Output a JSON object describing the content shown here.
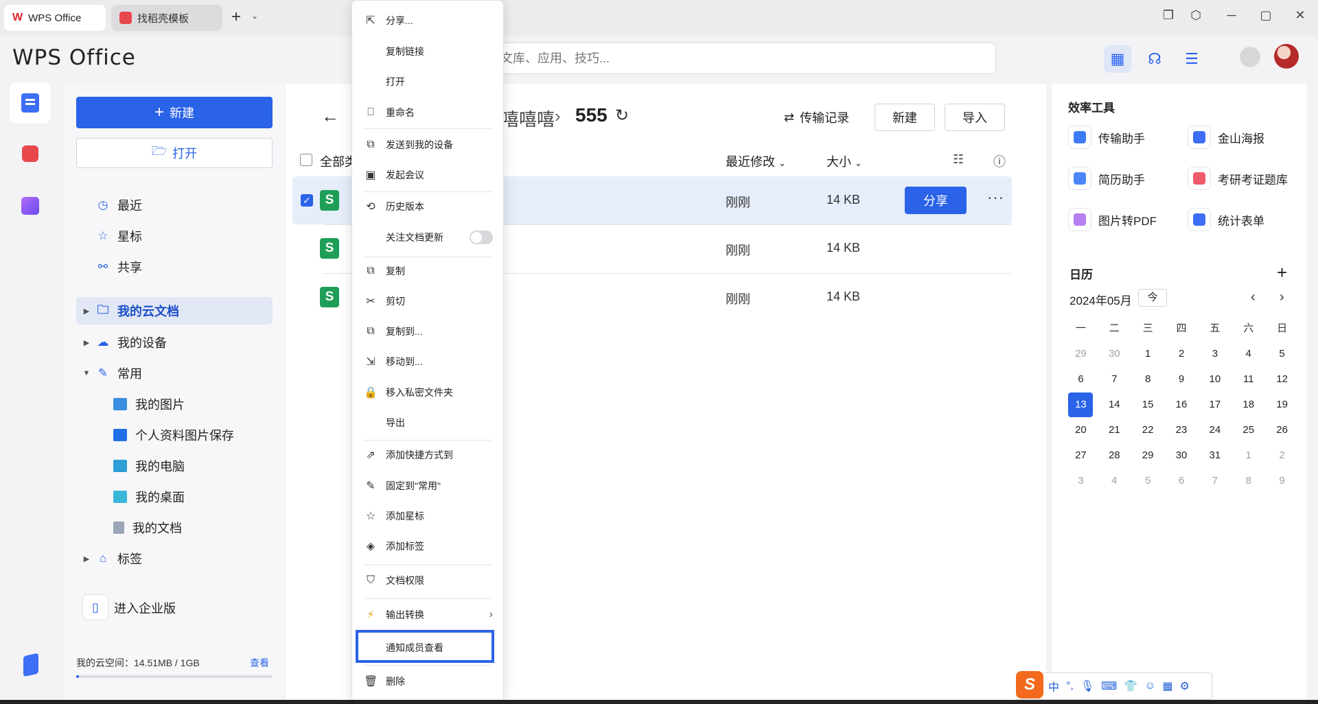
{
  "tabs": [
    {
      "label": "WPS Office"
    },
    {
      "label": "找稻壳模板"
    }
  ],
  "brand": "WPS Office",
  "search": {
    "placeholder": "文库、应用、技巧..."
  },
  "left": {
    "new_label": "新建",
    "open_label": "打开",
    "nav": [
      {
        "label": "最近"
      },
      {
        "label": "星标"
      },
      {
        "label": "共享"
      },
      {
        "label": "我的云文档"
      },
      {
        "label": "我的设备"
      },
      {
        "label": "常用"
      },
      {
        "label": "我的图片"
      },
      {
        "label": "个人资料图片保存"
      },
      {
        "label": "我的电脑"
      },
      {
        "label": "我的桌面"
      },
      {
        "label": "我的文档"
      },
      {
        "label": "标签"
      }
    ],
    "enterprise_label": "进入企业版",
    "quota_label": "我的云空间：14.51MB / 1GB",
    "quota_link": "查看",
    "quota_fraction": 0.014
  },
  "main": {
    "breadcrumb_prev": "嘻嘻嘻",
    "breadcrumb_current": "555",
    "transfer_label": "传输记录",
    "new_label": "新建",
    "import_label": "导入",
    "select_all_label": "全部类",
    "col_modified": "最近修改",
    "col_size": "大小",
    "rows": [
      {
        "icon": "S",
        "time": "刚刚",
        "size": "14 KB",
        "share": "分享"
      },
      {
        "icon": "S",
        "time": "刚刚",
        "size": "14 KB"
      },
      {
        "icon": "S",
        "time": "刚刚",
        "size": "14 KB"
      }
    ]
  },
  "right": {
    "tools_title": "效率工具",
    "tools": [
      {
        "label": "传输助手",
        "color": "#3d7bf5"
      },
      {
        "label": "金山海报",
        "color": "#3d6ef5"
      },
      {
        "label": "简历助手",
        "color": "#4a86f7"
      },
      {
        "label": "考研考证题库",
        "color": "#ef5b6a"
      },
      {
        "label": "图片转PDF",
        "color": "#b77ef0"
      },
      {
        "label": "统计表单",
        "color": "#3d6ef5"
      }
    ],
    "calendar_title": "日历",
    "month": "2024年05月",
    "today_btn": "今",
    "weekdays": [
      "一",
      "二",
      "三",
      "四",
      "五",
      "六",
      "日"
    ],
    "weeks": [
      [
        "29",
        "30",
        "1",
        "2",
        "3",
        "4",
        "5"
      ],
      [
        "6",
        "7",
        "8",
        "9",
        "10",
        "11",
        "12"
      ],
      [
        "13",
        "14",
        "15",
        "16",
        "17",
        "18",
        "19"
      ],
      [
        "20",
        "21",
        "22",
        "23",
        "24",
        "25",
        "26"
      ],
      [
        "27",
        "28",
        "29",
        "30",
        "31",
        "1",
        "2"
      ],
      [
        "3",
        "4",
        "5",
        "6",
        "7",
        "8",
        "9"
      ]
    ],
    "today": "13"
  },
  "menu": [
    {
      "label": "分享..."
    },
    {
      "label": "复制链接"
    },
    {
      "label": "打开"
    },
    {
      "label": "重命名"
    },
    {
      "label": "发送到我的设备"
    },
    {
      "label": "发起会议"
    },
    {
      "label": "历史版本"
    },
    {
      "label": "关注文档更新"
    },
    {
      "label": "复制"
    },
    {
      "label": "剪切"
    },
    {
      "label": "复制到..."
    },
    {
      "label": "移动到..."
    },
    {
      "label": "移入私密文件夹"
    },
    {
      "label": "导出"
    },
    {
      "label": "添加快捷方式到"
    },
    {
      "label": "固定到\"常用\""
    },
    {
      "label": "添加星标"
    },
    {
      "label": "添加标签"
    },
    {
      "label": "文档权限"
    },
    {
      "label": "输出转换"
    },
    {
      "label": "通知成员查看"
    },
    {
      "label": "删除"
    }
  ],
  "ime": {
    "logo": "S",
    "mode": "中",
    "punct": "°,"
  }
}
